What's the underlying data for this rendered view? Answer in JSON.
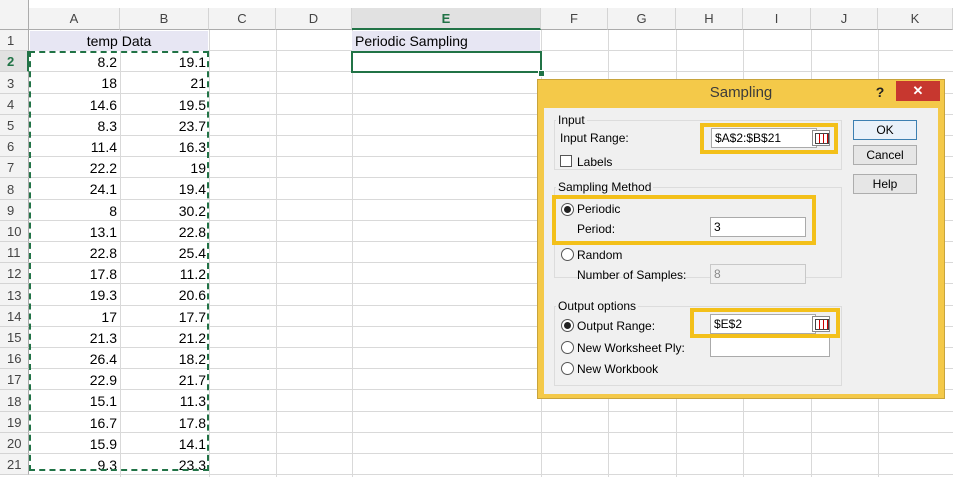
{
  "columns": [
    "A",
    "B",
    "C",
    "D",
    "E",
    "F",
    "G",
    "H",
    "I",
    "J",
    "K"
  ],
  "rows": [
    "1",
    "2",
    "3",
    "4",
    "5",
    "6",
    "7",
    "8",
    "9",
    "10",
    "11",
    "12",
    "13",
    "14",
    "15",
    "16",
    "17",
    "18",
    "19",
    "20",
    "21"
  ],
  "header_cell": "temp Data",
  "output_header": "Periodic Sampling",
  "data": [
    [
      "8.2",
      "19.1"
    ],
    [
      "18",
      "21"
    ],
    [
      "14.6",
      "19.5"
    ],
    [
      "8.3",
      "23.7"
    ],
    [
      "11.4",
      "16.3"
    ],
    [
      "22.2",
      "19"
    ],
    [
      "24.1",
      "19.4"
    ],
    [
      "8",
      "30.2"
    ],
    [
      "13.1",
      "22.8"
    ],
    [
      "22.8",
      "25.4"
    ],
    [
      "17.8",
      "11.2"
    ],
    [
      "19.3",
      "20.6"
    ],
    [
      "17",
      "17.7"
    ],
    [
      "21.3",
      "21.2"
    ],
    [
      "26.4",
      "18.2"
    ],
    [
      "22.9",
      "21.7"
    ],
    [
      "15.1",
      "11.3"
    ],
    [
      "16.7",
      "17.8"
    ],
    [
      "15.9",
      "14.1"
    ],
    [
      "9.3",
      "23.3"
    ]
  ],
  "dialog": {
    "title": "Sampling",
    "help_glyph": "?",
    "close_glyph": "✕",
    "input_group": "Input",
    "input_range_label": "Input Range:",
    "input_range_value": "$A$2:$B$21",
    "labels_label": "Labels",
    "method_group": "Sampling Method",
    "periodic_label": "Periodic",
    "period_label": "Period:",
    "period_value": "3",
    "random_label": "Random",
    "num_samples_label": "Number of Samples:",
    "num_samples_value": "8",
    "output_group": "Output options",
    "output_range_label": "Output Range:",
    "output_range_value": "$E$2",
    "new_ply_label": "New Worksheet Ply:",
    "new_ply_value": "",
    "new_workbook_label": "New Workbook",
    "ok": "OK",
    "cancel": "Cancel",
    "help": "Help"
  },
  "colors": {
    "excel_green": "#217346",
    "highlight": "#f3c01a",
    "dialog_frame": "#f4c949",
    "header_fill": "#e7e6f3"
  }
}
